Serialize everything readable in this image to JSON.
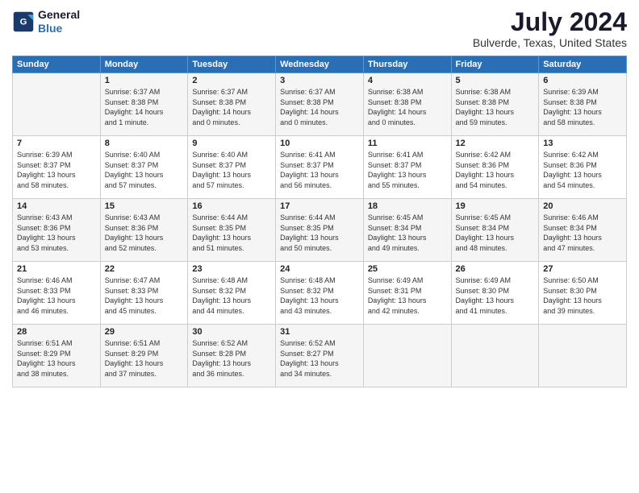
{
  "logo": {
    "line1": "General",
    "line2": "Blue"
  },
  "title": "July 2024",
  "location": "Bulverde, Texas, United States",
  "weekdays": [
    "Sunday",
    "Monday",
    "Tuesday",
    "Wednesday",
    "Thursday",
    "Friday",
    "Saturday"
  ],
  "weeks": [
    [
      {
        "day": "",
        "info": ""
      },
      {
        "day": "1",
        "info": "Sunrise: 6:37 AM\nSunset: 8:38 PM\nDaylight: 14 hours\nand 1 minute."
      },
      {
        "day": "2",
        "info": "Sunrise: 6:37 AM\nSunset: 8:38 PM\nDaylight: 14 hours\nand 0 minutes."
      },
      {
        "day": "3",
        "info": "Sunrise: 6:37 AM\nSunset: 8:38 PM\nDaylight: 14 hours\nand 0 minutes."
      },
      {
        "day": "4",
        "info": "Sunrise: 6:38 AM\nSunset: 8:38 PM\nDaylight: 14 hours\nand 0 minutes."
      },
      {
        "day": "5",
        "info": "Sunrise: 6:38 AM\nSunset: 8:38 PM\nDaylight: 13 hours\nand 59 minutes."
      },
      {
        "day": "6",
        "info": "Sunrise: 6:39 AM\nSunset: 8:38 PM\nDaylight: 13 hours\nand 58 minutes."
      }
    ],
    [
      {
        "day": "7",
        "info": "Sunrise: 6:39 AM\nSunset: 8:37 PM\nDaylight: 13 hours\nand 58 minutes."
      },
      {
        "day": "8",
        "info": "Sunrise: 6:40 AM\nSunset: 8:37 PM\nDaylight: 13 hours\nand 57 minutes."
      },
      {
        "day": "9",
        "info": "Sunrise: 6:40 AM\nSunset: 8:37 PM\nDaylight: 13 hours\nand 57 minutes."
      },
      {
        "day": "10",
        "info": "Sunrise: 6:41 AM\nSunset: 8:37 PM\nDaylight: 13 hours\nand 56 minutes."
      },
      {
        "day": "11",
        "info": "Sunrise: 6:41 AM\nSunset: 8:37 PM\nDaylight: 13 hours\nand 55 minutes."
      },
      {
        "day": "12",
        "info": "Sunrise: 6:42 AM\nSunset: 8:36 PM\nDaylight: 13 hours\nand 54 minutes."
      },
      {
        "day": "13",
        "info": "Sunrise: 6:42 AM\nSunset: 8:36 PM\nDaylight: 13 hours\nand 54 minutes."
      }
    ],
    [
      {
        "day": "14",
        "info": "Sunrise: 6:43 AM\nSunset: 8:36 PM\nDaylight: 13 hours\nand 53 minutes."
      },
      {
        "day": "15",
        "info": "Sunrise: 6:43 AM\nSunset: 8:36 PM\nDaylight: 13 hours\nand 52 minutes."
      },
      {
        "day": "16",
        "info": "Sunrise: 6:44 AM\nSunset: 8:35 PM\nDaylight: 13 hours\nand 51 minutes."
      },
      {
        "day": "17",
        "info": "Sunrise: 6:44 AM\nSunset: 8:35 PM\nDaylight: 13 hours\nand 50 minutes."
      },
      {
        "day": "18",
        "info": "Sunrise: 6:45 AM\nSunset: 8:34 PM\nDaylight: 13 hours\nand 49 minutes."
      },
      {
        "day": "19",
        "info": "Sunrise: 6:45 AM\nSunset: 8:34 PM\nDaylight: 13 hours\nand 48 minutes."
      },
      {
        "day": "20",
        "info": "Sunrise: 6:46 AM\nSunset: 8:34 PM\nDaylight: 13 hours\nand 47 minutes."
      }
    ],
    [
      {
        "day": "21",
        "info": "Sunrise: 6:46 AM\nSunset: 8:33 PM\nDaylight: 13 hours\nand 46 minutes."
      },
      {
        "day": "22",
        "info": "Sunrise: 6:47 AM\nSunset: 8:33 PM\nDaylight: 13 hours\nand 45 minutes."
      },
      {
        "day": "23",
        "info": "Sunrise: 6:48 AM\nSunset: 8:32 PM\nDaylight: 13 hours\nand 44 minutes."
      },
      {
        "day": "24",
        "info": "Sunrise: 6:48 AM\nSunset: 8:32 PM\nDaylight: 13 hours\nand 43 minutes."
      },
      {
        "day": "25",
        "info": "Sunrise: 6:49 AM\nSunset: 8:31 PM\nDaylight: 13 hours\nand 42 minutes."
      },
      {
        "day": "26",
        "info": "Sunrise: 6:49 AM\nSunset: 8:30 PM\nDaylight: 13 hours\nand 41 minutes."
      },
      {
        "day": "27",
        "info": "Sunrise: 6:50 AM\nSunset: 8:30 PM\nDaylight: 13 hours\nand 39 minutes."
      }
    ],
    [
      {
        "day": "28",
        "info": "Sunrise: 6:51 AM\nSunset: 8:29 PM\nDaylight: 13 hours\nand 38 minutes."
      },
      {
        "day": "29",
        "info": "Sunrise: 6:51 AM\nSunset: 8:29 PM\nDaylight: 13 hours\nand 37 minutes."
      },
      {
        "day": "30",
        "info": "Sunrise: 6:52 AM\nSunset: 8:28 PM\nDaylight: 13 hours\nand 36 minutes."
      },
      {
        "day": "31",
        "info": "Sunrise: 6:52 AM\nSunset: 8:27 PM\nDaylight: 13 hours\nand 34 minutes."
      },
      {
        "day": "",
        "info": ""
      },
      {
        "day": "",
        "info": ""
      },
      {
        "day": "",
        "info": ""
      }
    ]
  ]
}
